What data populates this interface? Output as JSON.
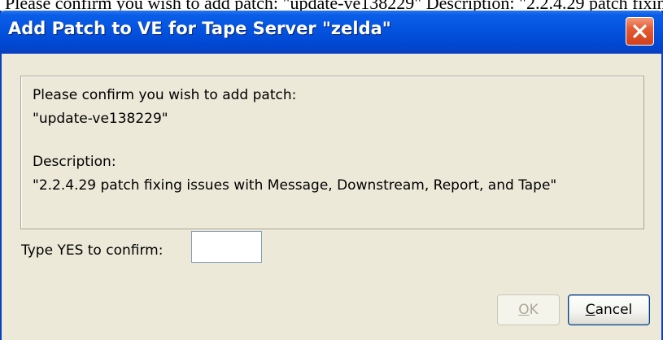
{
  "background_text": "Please confirm you wish to add patch: \"update-ve138229\"   Description: \"2.2.4.29 patch fixing issues with Message, Downstream, Report, and Tape\", type",
  "dialog": {
    "title": "Add Patch to VE for Tape Server \"zelda\"",
    "close_icon": "close-x-icon",
    "message": {
      "line1": "Please confirm you wish to add patch:",
      "line2": "\"update-ve138229\"",
      "line3": "Description:",
      "line4": "\"2.2.4.29 patch fixing issues with Message, Downstream, Report, and Tape\""
    },
    "confirm": {
      "label": "Type YES to confirm:",
      "value": "",
      "placeholder": ""
    },
    "buttons": {
      "ok": {
        "mnemonic": "O",
        "rest": "K",
        "enabled": false
      },
      "cancel": {
        "mnemonic": "C",
        "rest": "ancel",
        "enabled": true
      }
    }
  },
  "colors": {
    "titlebar": "#0453df",
    "close_button": "#e45c35",
    "dialog_background": "#ece9d8"
  }
}
